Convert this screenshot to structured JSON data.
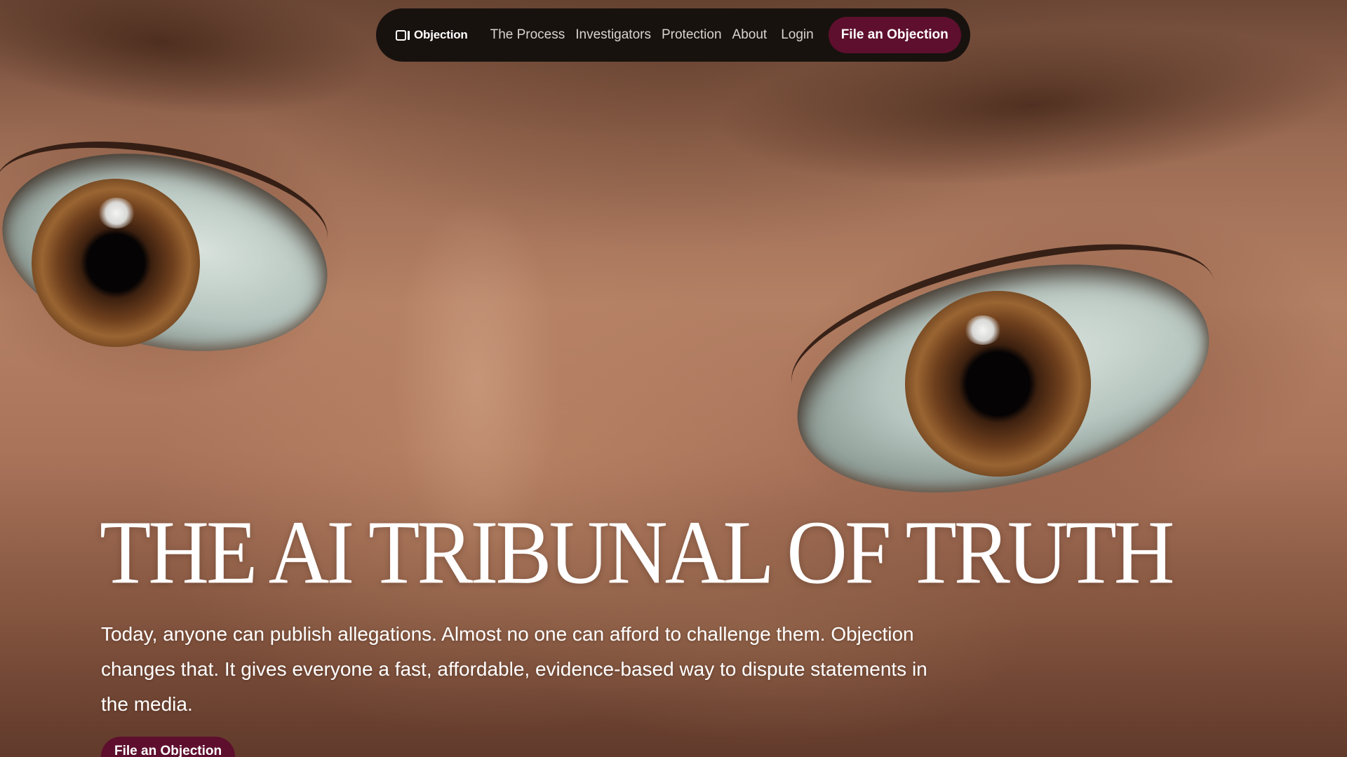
{
  "nav": {
    "logo_text": "Objection",
    "links": [
      {
        "label": "The Process"
      },
      {
        "label": "Investigators"
      },
      {
        "label": "Protection"
      },
      {
        "label": "About"
      }
    ],
    "login_label": "Login",
    "cta_label": "File an Objection"
  },
  "hero": {
    "headline": "THE AI TRIBUNAL OF TRUTH",
    "subtext": "Today, anyone can publish allegations. Almost no one can afford to challenge them. Objection changes that. It gives everyone a fast, affordable, evidence-based way to dispute statements in the media.",
    "cta_label": "File an Objection",
    "background_image": "painted close-up of a face with two brown eyes"
  },
  "colors": {
    "nav_background": "#18120f",
    "accent": "#5e0f2d",
    "text": "#ffffff",
    "nav_link_text": "#d9d4cf"
  }
}
